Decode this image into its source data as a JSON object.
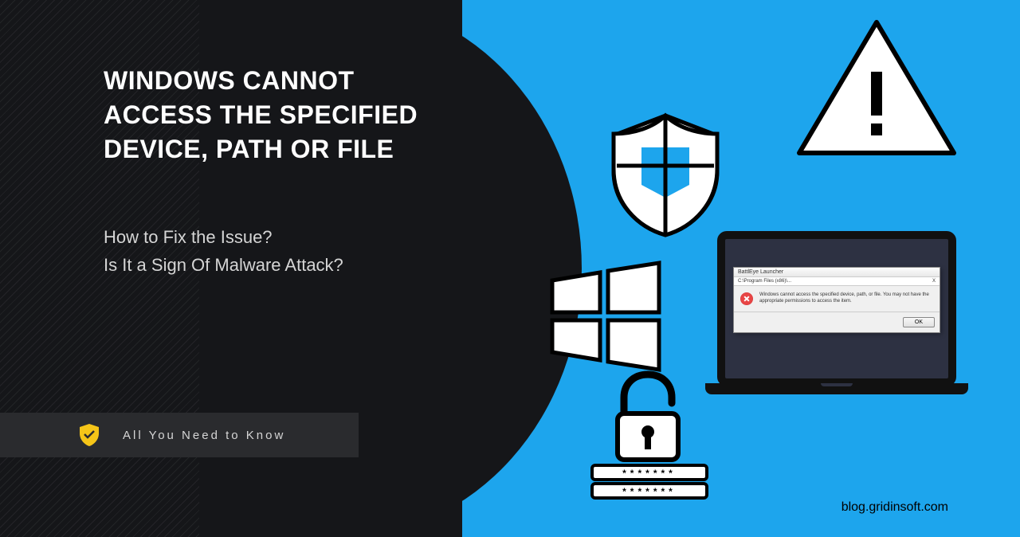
{
  "title": "WINDOWS CANNOT ACCESS THE SPECIFIED DEVICE, PATH OR FILE",
  "subtitle_line1": "How to Fix the Issue?",
  "subtitle_line2": "Is It a Sign Of Malware Attack?",
  "banner_text": "All You Need to Know",
  "blog_url": "blog.gridinsoft.com",
  "dialog": {
    "title": "BattlEye Launcher",
    "path": "C:\\Program Files (x86)\\...",
    "close": "X",
    "message": "Windows cannot access the specified device, path, or file. You may not have the appropriate permissions to access the item.",
    "ok_label": "OK"
  },
  "colors": {
    "dark_bg": "#151619",
    "blue_bg": "#1da5ed",
    "bar_bg": "#2a2b2e",
    "white": "#ffffff",
    "yellow_shield": "#f5c518"
  }
}
